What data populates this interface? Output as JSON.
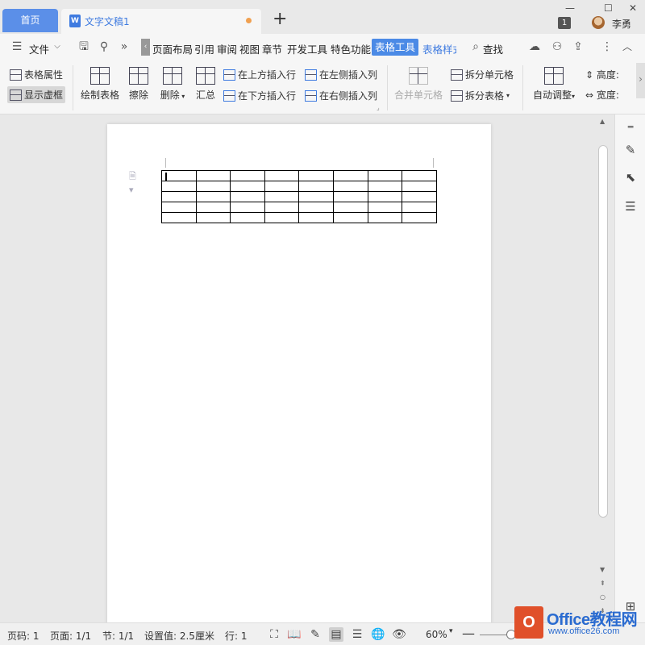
{
  "titlebar": {
    "home_tab": "首页",
    "doc_tab": "文字文稿1",
    "doc_icon": "W",
    "new_tab": "+",
    "notif_count": "1",
    "username": "李勇"
  },
  "menubar": {
    "file": "文件",
    "tabs": [
      "页面布局",
      "引用",
      "审阅",
      "视图",
      "章节",
      "开发工具",
      "特色功能",
      "表格工具",
      "表格样式"
    ],
    "search": "查找"
  },
  "ribbon": {
    "table_props": "表格属性",
    "show_gridlines": "显示虚框",
    "draw_table": "绘制表格",
    "erase": "擦除",
    "delete": "删除",
    "summary": "汇总",
    "insert_above": "在上方插入行",
    "insert_below": "在下方插入行",
    "insert_left": "在左侧插入列",
    "insert_right": "在右侧插入列",
    "merge_cells": "合并单元格",
    "split_cells": "拆分单元格",
    "split_table": "拆分表格",
    "auto_fit": "自动调整",
    "height": "高度:",
    "width": "宽度:"
  },
  "document": {
    "table_rows": 5,
    "table_cols": 8
  },
  "statusbar": {
    "page_num": "页码: 1",
    "pages": "页面: 1/1",
    "section": "节: 1/1",
    "setting": "设置值: 2.5厘米",
    "row": "行: 1",
    "zoom": "60%"
  },
  "watermark": {
    "logo_letter": "O",
    "logo_text": "Office教程网",
    "logo_url": "www.office26.com"
  },
  "colors": {
    "accent": "#5b8fe8",
    "table_tools_tab": "#4b8ae6",
    "logo": "#e0502a"
  }
}
